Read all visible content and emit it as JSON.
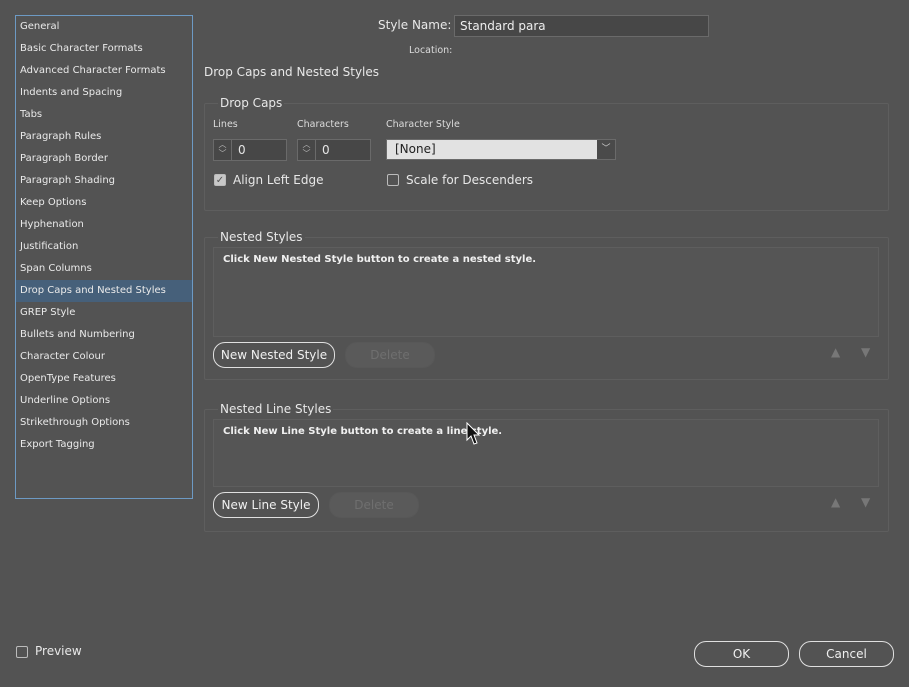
{
  "sidebar": {
    "items": [
      {
        "label": "General"
      },
      {
        "label": "Basic Character Formats"
      },
      {
        "label": "Advanced Character Formats"
      },
      {
        "label": "Indents and Spacing"
      },
      {
        "label": "Tabs"
      },
      {
        "label": "Paragraph Rules"
      },
      {
        "label": "Paragraph Border"
      },
      {
        "label": "Paragraph Shading"
      },
      {
        "label": "Keep Options"
      },
      {
        "label": "Hyphenation"
      },
      {
        "label": "Justification"
      },
      {
        "label": "Span Columns"
      },
      {
        "label": "Drop Caps and Nested Styles",
        "selected": true
      },
      {
        "label": "GREP Style"
      },
      {
        "label": "Bullets and Numbering"
      },
      {
        "label": "Character Colour"
      },
      {
        "label": "OpenType Features"
      },
      {
        "label": "Underline Options"
      },
      {
        "label": "Strikethrough Options"
      },
      {
        "label": "Export Tagging"
      }
    ]
  },
  "header": {
    "style_name_label": "Style Name:",
    "style_name_value": "Standard para",
    "location_label": "Location:",
    "section_title": "Drop Caps and Nested Styles"
  },
  "drop_caps": {
    "title": "Drop Caps",
    "lines_label": "Lines",
    "lines_value": "0",
    "characters_label": "Characters",
    "characters_value": "0",
    "char_style_label": "Character Style",
    "char_style_value": "[None]",
    "align_left_edge": "Align Left Edge",
    "align_left_checked": true,
    "scale_descenders": "Scale for Descenders",
    "scale_checked": false
  },
  "nested_styles": {
    "title": "Nested Styles",
    "hint": "Click New Nested Style button to create a nested style.",
    "new_button": "New Nested Style",
    "delete_button": "Delete"
  },
  "nested_line_styles": {
    "title": "Nested Line Styles",
    "hint": "Click New Line Style button to create a line style.",
    "new_button": "New Line Style",
    "delete_button": "Delete"
  },
  "footer": {
    "preview_label": "Preview",
    "preview_checked": false,
    "ok": "OK",
    "cancel": "Cancel"
  },
  "colors": {
    "background": "#535353",
    "selection": "#46607a",
    "sidebar_border": "#6d9ac4"
  }
}
